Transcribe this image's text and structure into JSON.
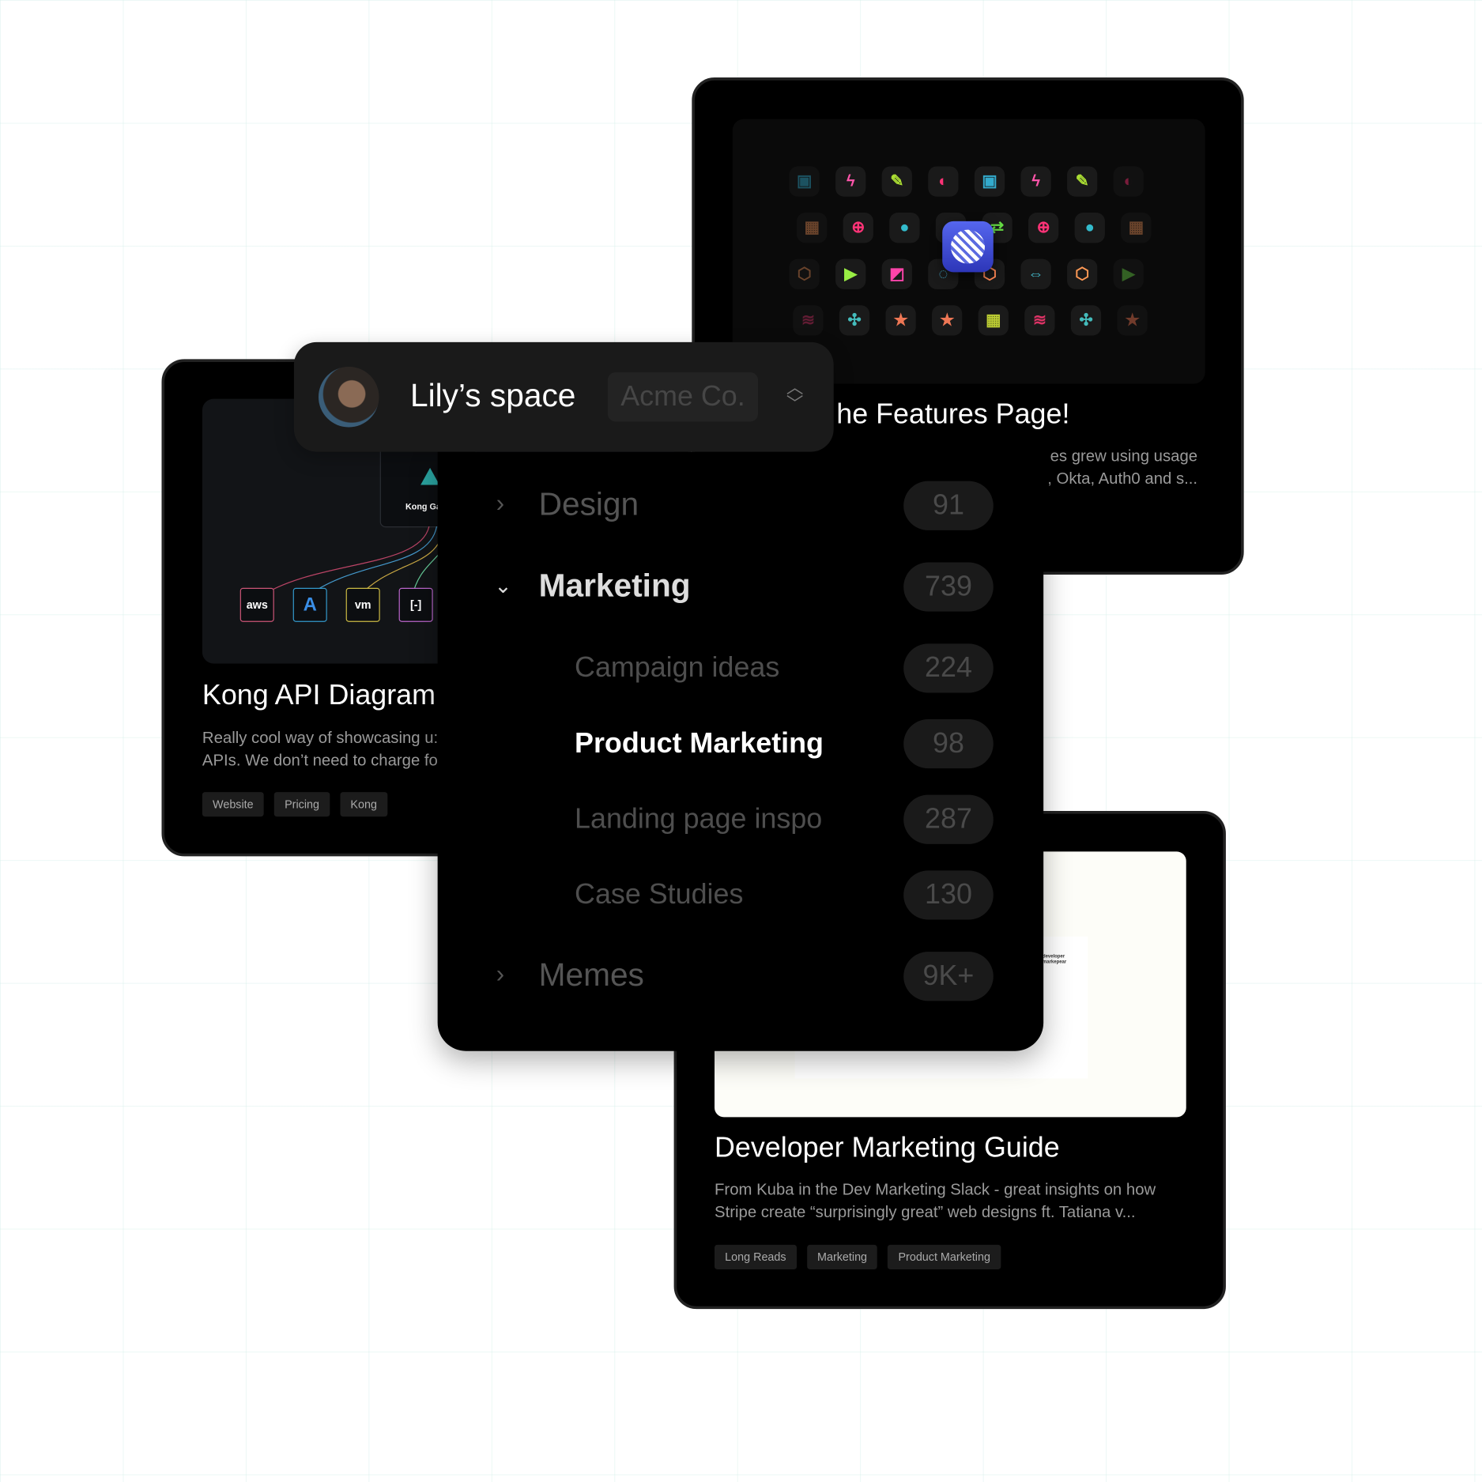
{
  "header": {
    "workspace": "Lily’s space",
    "organization": "Acme Co.",
    "switch_icon": "chevron-up-down-icon"
  },
  "menu": {
    "items": [
      {
        "label": "Design",
        "count": "91",
        "icon": "chevron-right-icon",
        "level": 0
      },
      {
        "label": "Marketing",
        "count": "739",
        "icon": "chevron-down-icon",
        "level": 0,
        "expanded": true
      },
      {
        "label": "Campaign ideas",
        "count": "224",
        "level": 1
      },
      {
        "label": "Product Marketing",
        "count": "98",
        "level": 1,
        "selected": true
      },
      {
        "label": "Landing page inspo",
        "count": "287",
        "level": 1
      },
      {
        "label": "Case Studies",
        "count": "130",
        "level": 1
      },
      {
        "label": "Memes",
        "count": "9K+",
        "icon": "chevron-right-icon",
        "level": 0
      }
    ]
  },
  "cards": {
    "features": {
      "title": "he Features Page!",
      "desc_line1": "es grew using usage",
      "desc_line2": ", Okta, Auth0 and s...",
      "icons": [
        [
          "#3ac",
          "#f5a",
          "#ad3",
          "#f37",
          "#3ac",
          "#f5a",
          "#ad3",
          "#f37"
        ],
        [
          "#d85",
          "#f37",
          "#3bc",
          "#f84",
          "#6d4",
          "#f37",
          "#3bc",
          "#d85"
        ],
        [
          "#d85",
          "#9e4",
          "#f4a",
          "#4ac",
          "#f85",
          "#4bc",
          "#f95",
          "#6c4"
        ],
        [
          "#c36",
          "#4bb",
          "#e75",
          "#e75",
          "#bc3",
          "#d36",
          "#4bb",
          "#e75"
        ]
      ],
      "icon_glyphs": [
        [
          "▣",
          "ϟ",
          "✎",
          "◐",
          "▣",
          "ϟ",
          "✎",
          "◐"
        ],
        [
          "▦",
          "⊕",
          "●",
          "",
          "⇄",
          "⊕",
          "●",
          "▦"
        ],
        [
          "⬡",
          "▶",
          "◩",
          "◌",
          "⬡",
          "⇔",
          "⬡",
          "▶"
        ],
        [
          "≋",
          "✣",
          "★",
          "★",
          "▦",
          "≋",
          "✣",
          "★"
        ]
      ],
      "app_icon": "linear-app-icon",
      "app_color": "#3b4bd8"
    },
    "kong": {
      "title": "Kong API Diagram",
      "desc_line1": "Really cool way of showcasing u:",
      "desc_line2": "APIs. We don’t need to charge fo",
      "tags": [
        "Website",
        "Pricing",
        "Kong"
      ],
      "gateway_label": "Kong Ga",
      "providers": [
        "aws",
        "A",
        "vm",
        "[-]"
      ]
    },
    "devguide": {
      "title": "Developer Marketing Guide",
      "desc_line1": "From Kuba in the Dev Marketing Slack - great insights on how",
      "desc_line2": "Stripe create “surprisingly great” web designs ft. Tatiana v...",
      "tags": [
        "Long Reads",
        "Marketing",
        "Product Marketing"
      ],
      "thumb_logo": "developer markepear"
    }
  }
}
